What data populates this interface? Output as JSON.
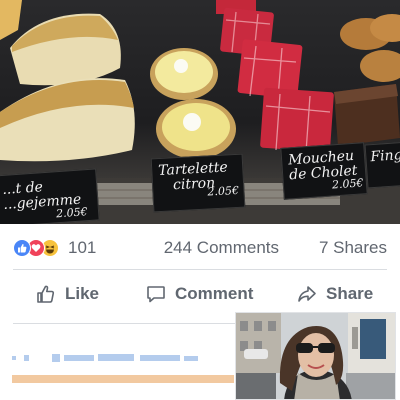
{
  "photo": {
    "tags": [
      {
        "line1": "...t de",
        "line2": "...gejemme",
        "price": "2.05€"
      },
      {
        "line1": "Tartelette",
        "line2": "citron",
        "price": "2.05€"
      },
      {
        "line1": "Moucheu",
        "line2": "de Cholet",
        "price": "2.05€"
      },
      {
        "line1": "Fing..."
      }
    ]
  },
  "reactions": {
    "icons": [
      "like-icon",
      "love-icon",
      "haha-icon"
    ],
    "colors": {
      "like": "#4a86f7",
      "love": "#f0425a",
      "haha": "#f7c23c"
    },
    "count": "101"
  },
  "engagement": {
    "comments": "244 Comments",
    "shares": "7 Shares"
  },
  "actions": {
    "like": "Like",
    "comment": "Comment",
    "share": "Share"
  },
  "accent": "#f2c9a0"
}
